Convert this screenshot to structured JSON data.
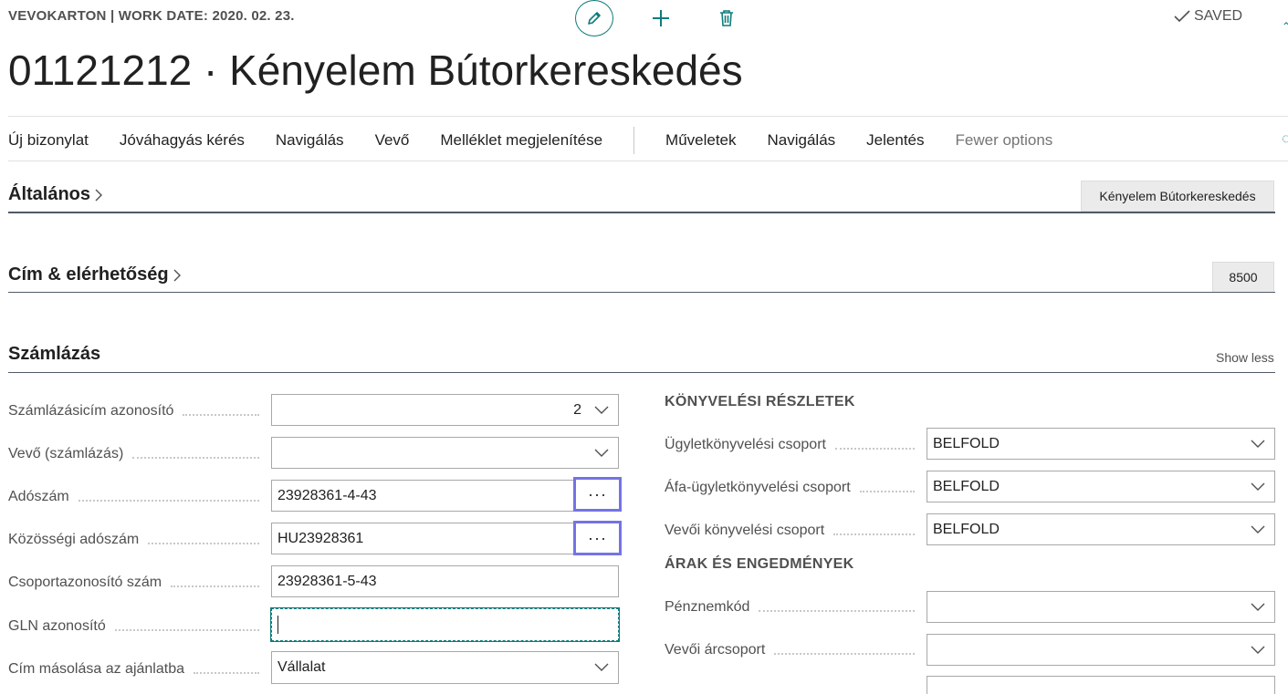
{
  "header": {
    "caption": "VEVOKARTON | WORK DATE: 2020. 02. 23.",
    "saved_label": "SAVED",
    "title": "01121212 · Kényelem Bútorkereskedés",
    "icons": {
      "edit": "pencil-icon",
      "new": "plus-icon",
      "delete": "trash-icon",
      "saved": "check-icon"
    },
    "accent_color": "#0f7b7b"
  },
  "actions": {
    "group1": [
      "Új bizonylat",
      "Jóváhagyás kérés",
      "Navigálás",
      "Vevő",
      "Melléklet megjelenítése"
    ],
    "group2": [
      "Műveletek",
      "Navigálás",
      "Jelentés"
    ],
    "fewer_options": "Fewer options"
  },
  "sections": {
    "general": {
      "title": "Általános",
      "summary": "Kényelem Bútorkereskedés"
    },
    "address": {
      "title": "Cím & elérhetőség",
      "summary": "8500"
    },
    "invoicing": {
      "title": "Számlázás",
      "toggle": "Show less"
    }
  },
  "invoicing_fields": [
    {
      "label": "Számlázásicím azonosító",
      "value": "2",
      "type": "dropdown"
    },
    {
      "label": "Vevő (számlázás)",
      "value": "",
      "type": "dropdown"
    },
    {
      "label": "Adószám",
      "value": "23928361-4-43",
      "type": "assist",
      "assist": "···"
    },
    {
      "label": "Közösségi adószám",
      "value": "HU23928361",
      "type": "assist",
      "assist": "···"
    },
    {
      "label": "Csoportazonosító szám",
      "value": "23928361-5-43",
      "type": "text"
    },
    {
      "label": "GLN azonosító",
      "value": "",
      "type": "text-focused"
    },
    {
      "label": "Cím másolása az ajánlatba",
      "value": "Vállalat",
      "type": "dropdown"
    }
  ],
  "posting": {
    "heading": "KÖNYVELÉSI RÉSZLETEK",
    "fields": [
      {
        "label": "Ügyletkönyvelési csoport",
        "value": "BELFOLD"
      },
      {
        "label": "Áfa-ügyletkönyvelési csoport",
        "value": "BELFOLD"
      },
      {
        "label": "Vevői könyvelési csoport",
        "value": "BELFOLD"
      }
    ]
  },
  "prices": {
    "heading": "ÁRAK ÉS ENGEDMÉNYEK",
    "fields": [
      {
        "label": "Pénznemkód",
        "value": ""
      },
      {
        "label": "Vevői árcsoport",
        "value": ""
      }
    ]
  }
}
